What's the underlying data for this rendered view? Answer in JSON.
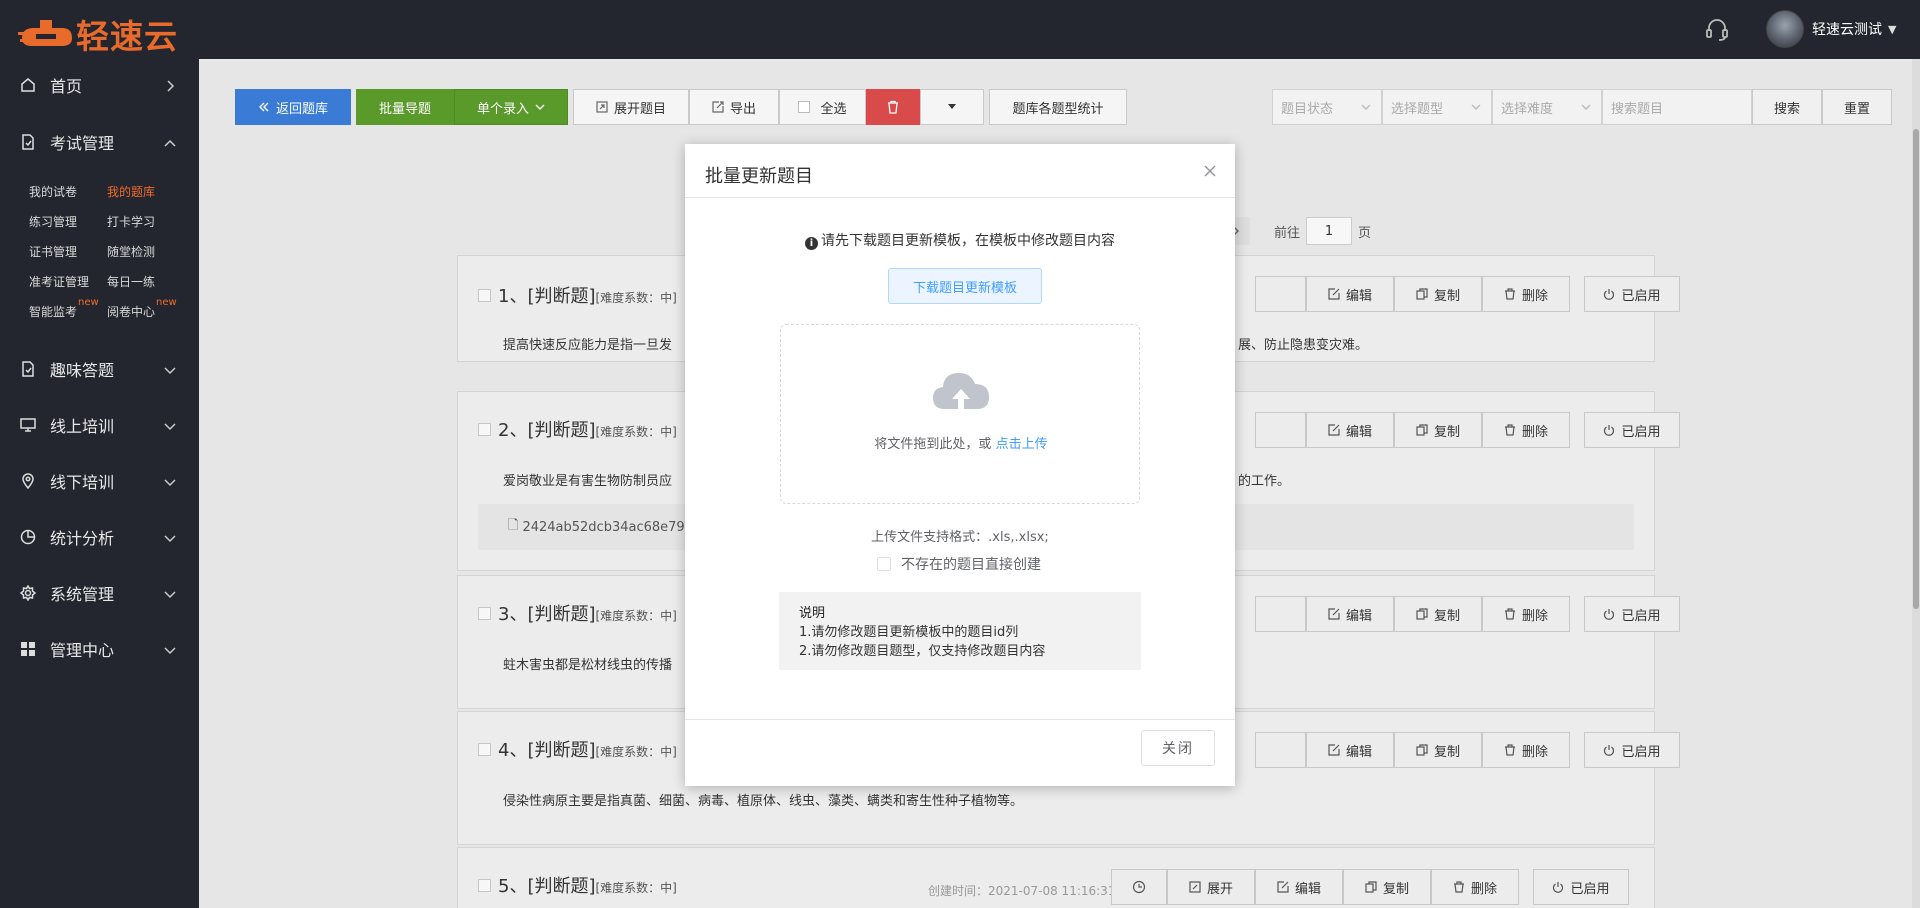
{
  "header": {
    "logo_text": "轻速云",
    "user_name": "轻速云测试",
    "colors": {
      "topbar": "#23262e",
      "brand": "#e96b2b"
    }
  },
  "sidebar": {
    "items": [
      {
        "label": "首页",
        "icon": "home-icon",
        "arrow": "right"
      },
      {
        "label": "考试管理",
        "icon": "document-icon",
        "arrow": "up"
      },
      {
        "label": "趣味答题",
        "icon": "quiz-icon",
        "arrow": "down"
      },
      {
        "label": "线上培训",
        "icon": "monitor-icon",
        "arrow": "down"
      },
      {
        "label": "线下培训",
        "icon": "location-icon",
        "arrow": "down"
      },
      {
        "label": "统计分析",
        "icon": "pie-icon",
        "arrow": "down"
      },
      {
        "label": "系统管理",
        "icon": "settings-icon",
        "arrow": "down"
      },
      {
        "label": "管理中心",
        "icon": "grid-icon",
        "arrow": "down"
      }
    ],
    "exam_submenu": [
      {
        "label": "我的试卷",
        "active": false,
        "new": false
      },
      {
        "label": "我的题库",
        "active": true,
        "new": false
      },
      {
        "label": "练习管理",
        "active": false,
        "new": false
      },
      {
        "label": "打卡学习",
        "active": false,
        "new": false
      },
      {
        "label": "证书管理",
        "active": false,
        "new": false
      },
      {
        "label": "随堂检测",
        "active": false,
        "new": false
      },
      {
        "label": "准考证管理",
        "active": false,
        "new": false
      },
      {
        "label": "每日一练",
        "active": false,
        "new": false
      },
      {
        "label": "智能监考",
        "active": false,
        "new": true
      },
      {
        "label": "阅卷中心",
        "active": false,
        "new": true
      }
    ],
    "new_badge": "new",
    "active_color": "#f06a2c"
  },
  "toolbar": {
    "back_label": "返回题库",
    "batch_import_label": "批量导题",
    "single_entry_label": "单个录入",
    "expand_label": "展开题目",
    "export_label": "导出",
    "select_all_label": "全选",
    "stats_label": "题库各题型统计",
    "colors": {
      "back": "#3a7bd5",
      "import": "#5a9a2b",
      "delete": "#d94a4a"
    }
  },
  "filters": {
    "status_placeholder": "题目状态",
    "type_placeholder": "选择题型",
    "difficulty_placeholder": "选择难度",
    "search_placeholder": "搜索题目",
    "search_label": "搜索",
    "reset_label": "重置"
  },
  "pager": {
    "goto_label": "前往",
    "page_value": "1",
    "page_suffix": "页"
  },
  "questions": [
    {
      "title": "1、[判断题]",
      "meta": "[难度系数：中]",
      "text_left": "提高快速反应能力是指一旦发",
      "text_right": "展、防止隐患变灾难。"
    },
    {
      "title": "2、[判断题]",
      "meta": "[难度系数：中]",
      "text_left": "爱岗敬业是有害生物防制员应",
      "text_right": "的工作。",
      "attachment": "2424ab52dcb34ac68e79d"
    },
    {
      "title": "3、[判断题]",
      "meta": "[难度系数：中]",
      "text_left": "蛀木害虫都是松材线虫的传播",
      "text_right": ""
    },
    {
      "title": "4、[判断题]",
      "meta": "[难度系数：中]",
      "text_left": "侵染性病原主要是指真菌、细菌、病毒、植原体、线虫、藻类、螨类和寄生性种子植物等。",
      "text_right": ""
    },
    {
      "title": "5、[判断题]",
      "meta": "[难度系数：中]",
      "text_left": "",
      "text_right": "",
      "created": "创建时间：2021-07-08 11:16:31"
    }
  ],
  "question_actions": {
    "expand_label": "展开",
    "edit_label": "编辑",
    "copy_label": "复制",
    "delete_label": "删除",
    "enabled_label": "已启用"
  },
  "modal": {
    "title": "批量更新题目",
    "notice": "请先下载题目更新模板，在模板中修改题目内容",
    "download_label": "下载题目更新模板",
    "drop_text": "将文件拖到此处，或",
    "upload_link": "点击上传",
    "formats": "上传文件支持格式：.xls,.xlsx;",
    "create_option": "不存在的题目直接创建",
    "note_title": "说明",
    "note_1": "1.请勿修改题目更新模板中的题目id列",
    "note_2": "2.请勿修改题目题型，仅支持修改题目内容",
    "close_label": "关闭",
    "link_color": "#409eff"
  }
}
